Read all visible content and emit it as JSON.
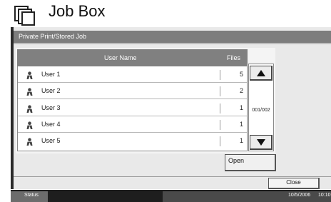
{
  "header": {
    "title": "Job Box",
    "icon": "document-stack-icon"
  },
  "subtitle": "Private Print/Stored Job",
  "table": {
    "columns": [
      "User Name",
      "Files"
    ],
    "rows": [
      {
        "name": "User 1",
        "files": "5"
      },
      {
        "name": "User 2",
        "files": "2"
      },
      {
        "name": "User 3",
        "files": "1"
      },
      {
        "name": "User 4",
        "files": "1"
      },
      {
        "name": "User 5",
        "files": "1"
      }
    ]
  },
  "pager": {
    "indicator": "001/002"
  },
  "buttons": {
    "open": "Open",
    "close": "Close"
  },
  "status": {
    "label": "Status",
    "date": "10/5/2006",
    "time": "10:10"
  }
}
